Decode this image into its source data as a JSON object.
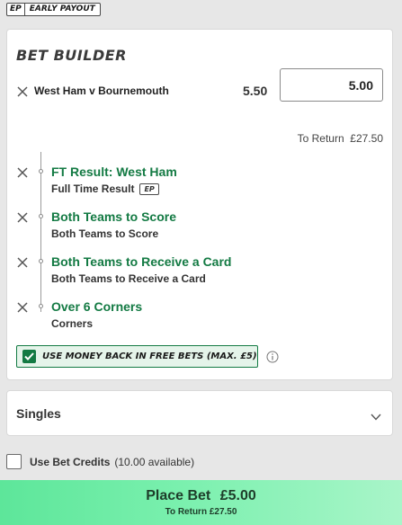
{
  "ep_banner": {
    "code": "EP",
    "text": "EARLY PAYOUT"
  },
  "bet_builder": {
    "title": "BET BUILDER",
    "match": "West Ham v Bournemouth",
    "odds": "5.50",
    "stake": "5.00",
    "to_return": "To Return  £27.50",
    "selections": [
      {
        "name": "FT Result: West Ham",
        "market": "Full Time Result",
        "ep_badge": "EP"
      },
      {
        "name": "Both Teams to Score",
        "market": "Both Teams to Score"
      },
      {
        "name": "Both Teams to Receive a Card",
        "market": "Both Teams to Receive a Card"
      },
      {
        "name": "Over 6 Corners",
        "market": "Corners"
      }
    ],
    "money_back": {
      "label": "USE MONEY BACK IN FREE BETS (MAX. £5)",
      "checked": true
    }
  },
  "singles": {
    "label": "Singles"
  },
  "bet_credits": {
    "label": "Use Bet Credits",
    "available": "(10.00 available)",
    "checked": false
  },
  "place_bet": {
    "label": "Place Bet",
    "amount": "£5.00",
    "to_return": "To Return £27.50"
  },
  "icons": {
    "remove": "close-icon",
    "info": "info-icon",
    "expand": "chevron-down-icon",
    "check": "check-icon"
  },
  "colors": {
    "accent_green": "#137a43",
    "place_bet_gradient": [
      "#5de69a",
      "#a9f5c9"
    ]
  }
}
